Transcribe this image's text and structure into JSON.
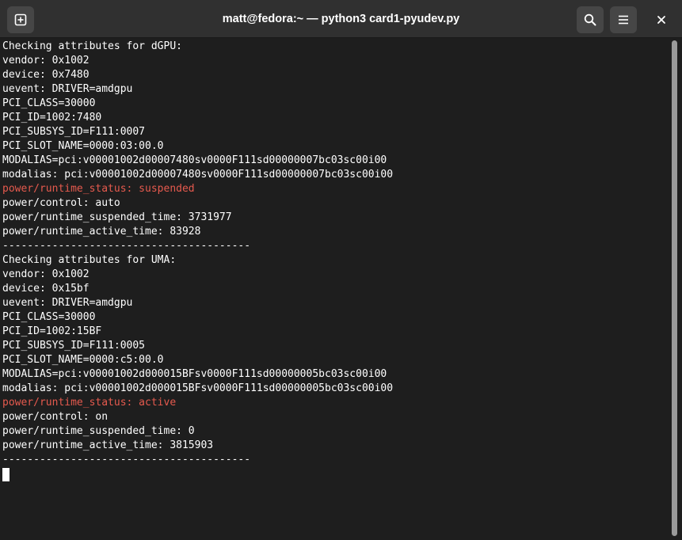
{
  "window": {
    "title": "matt@fedora:~ — python3 card1-pyudev.py"
  },
  "header": {
    "new_tab_icon": "plus-square-icon",
    "search_icon": "search-icon",
    "menu_icon": "hamburger-menu-icon",
    "close_icon": "close-icon"
  },
  "colors": {
    "text": "#ffffff",
    "highlight": "#e65a4e",
    "background": "#1e1e1e",
    "titlebar": "#303030"
  },
  "terminal": {
    "lines": [
      "Checking attributes for dGPU:",
      "vendor: 0x1002",
      "device: 0x7480",
      "uevent: DRIVER=amdgpu",
      "PCI_CLASS=30000",
      "PCI_ID=1002:7480",
      "PCI_SUBSYS_ID=F111:0007",
      "PCI_SLOT_NAME=0000:03:00.0",
      "MODALIAS=pci:v00001002d00007480sv0000F111sd00000007bc03sc00i00",
      "modalias: pci:v00001002d00007480sv0000F111sd00000007bc03sc00i00",
      "power/runtime_status: suspended",
      "power/control: auto",
      "power/runtime_suspended_time: 3731977",
      "power/runtime_active_time: 83928",
      "----------------------------------------",
      "Checking attributes for UMA:",
      "vendor: 0x1002",
      "device: 0x15bf",
      "uevent: DRIVER=amdgpu",
      "PCI_CLASS=30000",
      "PCI_ID=1002:15BF",
      "PCI_SUBSYS_ID=F111:0005",
      "PCI_SLOT_NAME=0000:c5:00.0",
      "MODALIAS=pci:v00001002d000015BFsv0000F111sd00000005bc03sc00i00",
      "modalias: pci:v00001002d000015BFsv0000F111sd00000005bc03sc00i00",
      "power/runtime_status: active",
      "power/control: on",
      "power/runtime_suspended_time: 0",
      "power/runtime_active_time: 3815903",
      "----------------------------------------"
    ]
  }
}
